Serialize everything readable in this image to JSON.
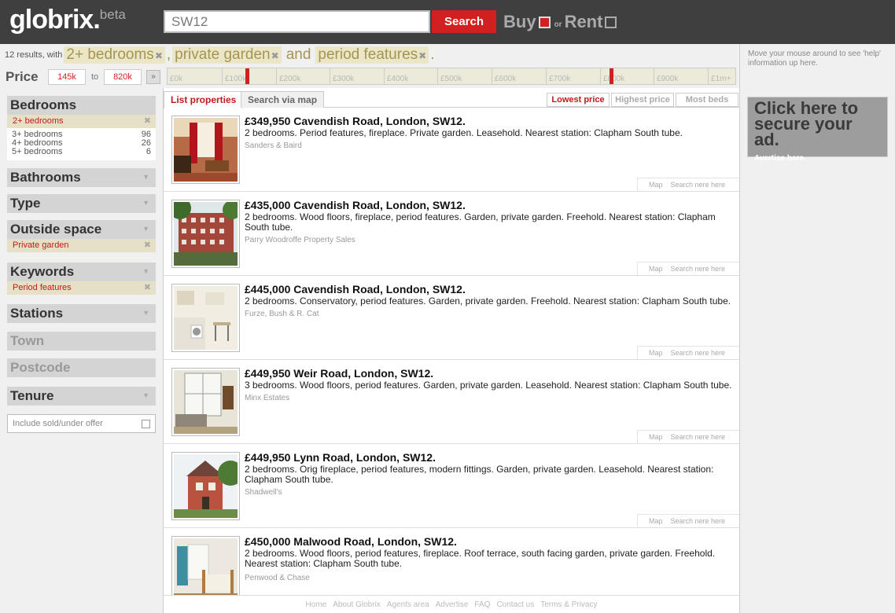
{
  "header": {
    "logo": "globrix.",
    "beta": "beta",
    "search_value": "SW12",
    "search_button": "Search",
    "buy_label": "Buy",
    "or_label": "or",
    "rent_label": "Rent"
  },
  "results": {
    "count_text": "12 results, with",
    "filter1": "2+ bedrooms",
    "filter2": "private garden",
    "and_text": "and",
    "filter3": "period features",
    "comma": ",",
    "period": ".",
    "x": "✖"
  },
  "help_text": "Move your mouse around to see 'help' information up here.",
  "price": {
    "label": "Price",
    "min": "145k",
    "to": "to",
    "max": "820k",
    "arrow": "»",
    "ticks": [
      "£0k",
      "£100k",
      "£200k",
      "£300k",
      "£400k",
      "£500k",
      "£600k",
      "£700k",
      "£800k",
      "£900k",
      "£1m+"
    ]
  },
  "sidebar": {
    "bedrooms": "Bedrooms",
    "bedrooms_selected": "2+ bedrooms",
    "bedroom_options": [
      {
        "label": "3+ bedrooms",
        "count": "96"
      },
      {
        "label": "4+ bedrooms",
        "count": "26"
      },
      {
        "label": "5+ bedrooms",
        "count": "6"
      }
    ],
    "bathrooms": "Bathrooms",
    "type": "Type",
    "outside_space": "Outside space",
    "outside_selected": "Private garden",
    "keywords": "Keywords",
    "keywords_selected": "Period features",
    "stations": "Stations",
    "town": "Town",
    "postcode": "Postcode",
    "tenure": "Tenure",
    "include_sold": "Include sold/under offer",
    "x": "✖",
    "tri": "▼"
  },
  "tabs": {
    "list": "List properties",
    "map": "Search via map",
    "lowest": "Lowest price",
    "highest": "Highest price",
    "beds": "Most beds"
  },
  "listings": [
    {
      "title": "£349,950 Cavendish Road, London, SW12.",
      "desc": "2 bedrooms. Period features, fireplace. Private garden. Leasehold. Nearest station: Clapham South tube.",
      "agent": "Sanders & Baird"
    },
    {
      "title": "£435,000 Cavendish Road, London, SW12.",
      "desc": "2 bedrooms. Wood floors, fireplace, period features. Garden, private garden. Freehold. Nearest station: Clapham South tube.",
      "agent": "Parry Woodroffe Property Sales"
    },
    {
      "title": "£445,000 Cavendish Road, London, SW12.",
      "desc": "2 bedrooms. Conservatory, period features. Garden, private garden. Freehold. Nearest station: Clapham South tube.",
      "agent": "Furze, Bush & R. Cat"
    },
    {
      "title": "£449,950 Weir Road, London, SW12.",
      "desc": "3 bedrooms. Wood floors, period features. Garden, private garden. Leasehold. Nearest station: Clapham South tube.",
      "agent": "Minx Estates"
    },
    {
      "title": "£449,950 Lynn Road, London, SW12.",
      "desc": "2 bedrooms. Orig fireplace, period features, modern fittings. Garden, private garden. Leasehold. Nearest station: Clapham South tube.",
      "agent": "Shadwell's"
    },
    {
      "title": "£450,000 Malwood Road, London, SW12.",
      "desc": "2 bedrooms. Wood floors, period features, fireplace. Roof terrace, south facing garden, private garden. Freehold. Nearest station: Clapham South tube.",
      "agent": "Penwood & Chase"
    }
  ],
  "item_links": {
    "map": "Map",
    "search": "Search nere here"
  },
  "footer": [
    "Home",
    "About Globrix",
    "Agents area",
    "Advertise",
    "FAQ",
    "Contact us",
    "Terms & Privacy"
  ],
  "ad": {
    "headline": "Click here to secure your ad.",
    "sub": "Avertise here."
  }
}
